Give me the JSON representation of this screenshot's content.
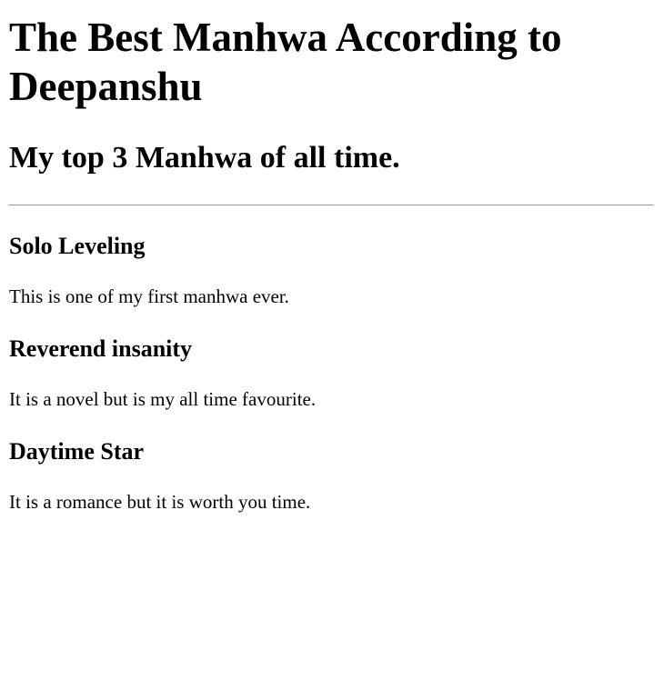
{
  "page": {
    "title": "The Best Manhwa According to Deepanshu",
    "subtitle": "My top 3 Manhwa of all time.",
    "entries": [
      {
        "name": "Solo Leveling",
        "description": "This is one of my first manhwa ever."
      },
      {
        "name": "Reverend insanity",
        "description": "It is a novel but is my all time favourite."
      },
      {
        "name": "Daytime Star",
        "description": "It is a romance but it is worth you time."
      }
    ]
  }
}
